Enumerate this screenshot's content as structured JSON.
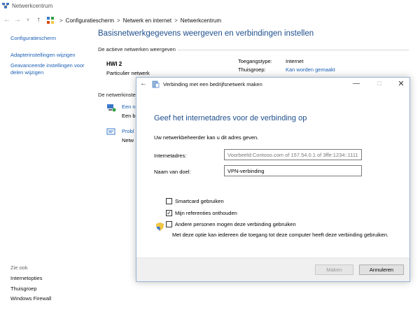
{
  "window": {
    "title": "Netwerkcentrum"
  },
  "addressbar": {
    "breadcrumbs": [
      "Configuratiescherm",
      "Netwerk en internet",
      "Netwerkcentrum"
    ]
  },
  "sidebar": {
    "home": "Configuratiescherm",
    "links": [
      "Adapterinstellingen wijzigen",
      "Geavanceerde instellingen voor delen wijzigen"
    ],
    "see_also_title": "Zie ook",
    "see_also": [
      "Internetopties",
      "Thuisgroep",
      "Windows Firewall"
    ]
  },
  "main": {
    "title": "Basisnetwerkgegevens weergeven en verbindingen instellen",
    "active_networks_label": "De actieve netwerken weergeven",
    "network": {
      "name": "HWI 2",
      "type": "Particulier netwerk"
    },
    "details": [
      {
        "label": "Toegangstype:",
        "value": "Internet"
      },
      {
        "label": "Thuisgroep:",
        "value": "Kan worden gemaakt"
      }
    ],
    "change_settings_label": "De netwerkinste",
    "tasks": [
      {
        "link": "Een n",
        "text": "Een b"
      },
      {
        "link": "Probl",
        "text": "Netw"
      }
    ]
  },
  "dialog": {
    "title": "Verbinding met een bedrijfsnetwerk maken",
    "heading": "Geef het internetadres voor de verbinding op",
    "intro": "Uw netwerkbeheerder kan u dit adres geven.",
    "address_label": "Internetadres:",
    "address_placeholder": "Voorbeeld:Contoso.com of 157.54.0.1 of 3ffe:1234::1111",
    "address_value": "",
    "destination_label": "Naam van doel:",
    "destination_value": "VPN-verbinding",
    "checkboxes": [
      {
        "label": "Smartcard gebruiken",
        "checked": false
      },
      {
        "label": "Mijn referenties onthouden",
        "checked": true
      },
      {
        "label": "Andere personen mogen deze verbinding gebruiken",
        "checked": false
      }
    ],
    "others_note": "Met deze optie kan iedereen die toegang tot deze computer heeft deze verbinding gebruiken.",
    "buttons": {
      "create": "Maken",
      "cancel": "Annuleren"
    }
  },
  "colors": {
    "accent_blue": "#1e4e8c",
    "link_blue": "#1a5fb4"
  }
}
